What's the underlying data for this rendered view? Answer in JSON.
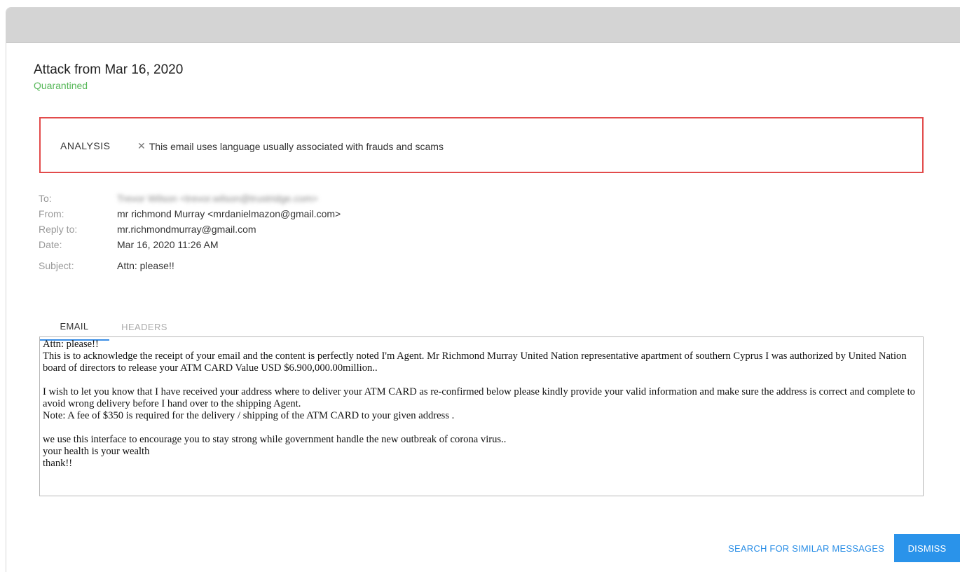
{
  "attack": {
    "title": "Attack from Mar 16, 2020",
    "status": "Quarantined",
    "status_color": "#58b85a"
  },
  "analysis": {
    "label": "ANALYSIS",
    "icon": "close-icon",
    "message": "This email uses language usually associated with frauds and scams",
    "border_color": "#e24b4b"
  },
  "meta": {
    "to_label": "To:",
    "to_value": "Trevor Wilson <trevor.wilson@trustridge.com>",
    "from_label": "From:",
    "from_value": "mr richmond Murray <mrdanielmazon@gmail.com>",
    "reply_label": "Reply to:",
    "reply_value": "mr.richmondmurray@gmail.com",
    "date_label": "Date:",
    "date_value": "Mar 16, 2020 11:26 AM",
    "subject_label": "Subject:",
    "subject_value": "Attn: please!!"
  },
  "tabs": [
    {
      "label": "EMAIL",
      "active": true
    },
    {
      "label": "HEADERS",
      "active": false
    }
  ],
  "email_body": "Attn: please!!\nThis is to acknowledge the receipt of your email and the content is perfectly noted I'm Agent. Mr Richmond Murray United Nation representative apartment of southern Cyprus I was authorized by United Nation board of directors to release your ATM CARD Value USD $6.900,000.00million..\n\nI wish to let you know that I have received your address where to deliver your ATM CARD as re-confirmed below please kindly provide your valid information and make sure the address is correct and complete to avoid wrong delivery before I hand over to the shipping Agent.\nNote: A fee of $350 is required for the delivery / shipping of the ATM CARD to your given address .\n\nwe use this interface to encourage you to stay strong while government handle the new outbreak of corona virus..\nyour health is your wealth\nthank!!",
  "actions": {
    "search_label": "SEARCH FOR SIMILAR MESSAGES",
    "dismiss_label": "DISMISS",
    "accent_color": "#2a93ea"
  }
}
